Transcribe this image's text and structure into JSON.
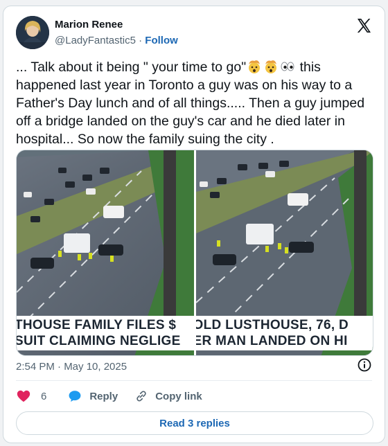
{
  "author": {
    "display_name": "Marion Renee",
    "handle": "@LadyFantastic5",
    "separator": " · ",
    "follow_label": "Follow"
  },
  "tweet": {
    "text_part1": "... Talk about it being \" your time to go\"",
    "emojis": [
      "exploding-head-emoji",
      "exploding-head-emoji",
      "eyes-emoji"
    ],
    "text_part2": " this happened last year in Toronto a guy was on his way to a Father's Day lunch and of all things..... Then a guy jumped off a bridge landed on the guy's car and he died later in hospital... So now the family suing the city ."
  },
  "media": [
    {
      "banner_line1": "THOUSE FAMILY FILES $",
      "banner_line2": "SUIT CLAIMING NEGLIGE"
    },
    {
      "banner_line1": "OLD LUSTHOUSE, 76, D",
      "banner_line2": "ER MAN LANDED ON HI"
    }
  ],
  "footer": {
    "timestamp": "2:54 PM · May 10, 2025",
    "like_count": "6",
    "reply_label": "Reply",
    "copy_link_label": "Copy link",
    "read_replies_label": "Read 3 replies"
  },
  "colors": {
    "link": "#1d68b4",
    "like": "#e0245e",
    "reply": "#1d9bf0",
    "muted": "#536471"
  }
}
